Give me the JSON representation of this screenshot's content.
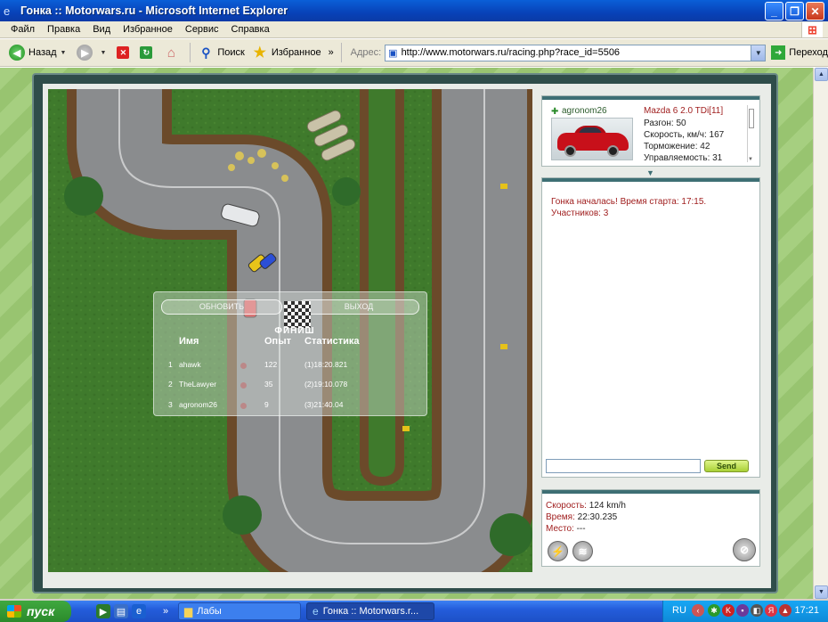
{
  "window": {
    "title": "Гонка :: Motorwars.ru - Microsoft Internet Explorer",
    "minimize": "_",
    "maximize": "❐",
    "close": "✕"
  },
  "menu": [
    "Файл",
    "Правка",
    "Вид",
    "Избранное",
    "Сервис",
    "Справка"
  ],
  "toolbar": {
    "back_label": "Назад",
    "search_label": "Поиск",
    "favorites_label": "Избранное",
    "more": "»",
    "address_label": "Адрес:",
    "address_value": "http://www.motorwars.ru/racing.php?race_id=5506",
    "go_label": "Переход"
  },
  "results": {
    "refresh_label": "ОБНОВИТЬ",
    "exit_label": "ВЫХОД",
    "finish_label": "ФИНИШ",
    "headers": {
      "name": "Имя",
      "exp": "Опыт",
      "stats": "Статистика"
    },
    "rows": [
      {
        "pos": "1",
        "name": "ahawk",
        "exp": "122",
        "stats": "(1)18:20.821"
      },
      {
        "pos": "2",
        "name": "TheLawyer",
        "exp": "35",
        "stats": "(2)19:10.078"
      },
      {
        "pos": "3",
        "name": "agronom26",
        "exp": "9",
        "stats": "(3)21:40.04"
      }
    ]
  },
  "car": {
    "player": "agronom26",
    "model": "Mazda 6 2.0 TDi[11]",
    "stats": [
      "Разгон: 50",
      "Скорость, км/ч: 167",
      "Торможение: 42",
      "Управляемость: 31"
    ]
  },
  "chat": {
    "messages": [
      "Гонка началась! Время старта: 17:15.",
      "Участников: 3"
    ],
    "input_value": "",
    "send_label": "Send"
  },
  "race_status": {
    "speed_label": "Скорость:",
    "speed_value": "124 km/h",
    "time_label": "Время:",
    "time_value": "22:30.235",
    "place_label": "Место:",
    "place_value": "---"
  },
  "taskbar": {
    "start_label": "пуск",
    "tasks": [
      {
        "label": "Лабы",
        "icon": "folder-icon"
      },
      {
        "label": "Гонка :: Motorwars.r...",
        "icon": "ie-icon"
      }
    ],
    "lang": "RU",
    "clock": "17:21"
  }
}
